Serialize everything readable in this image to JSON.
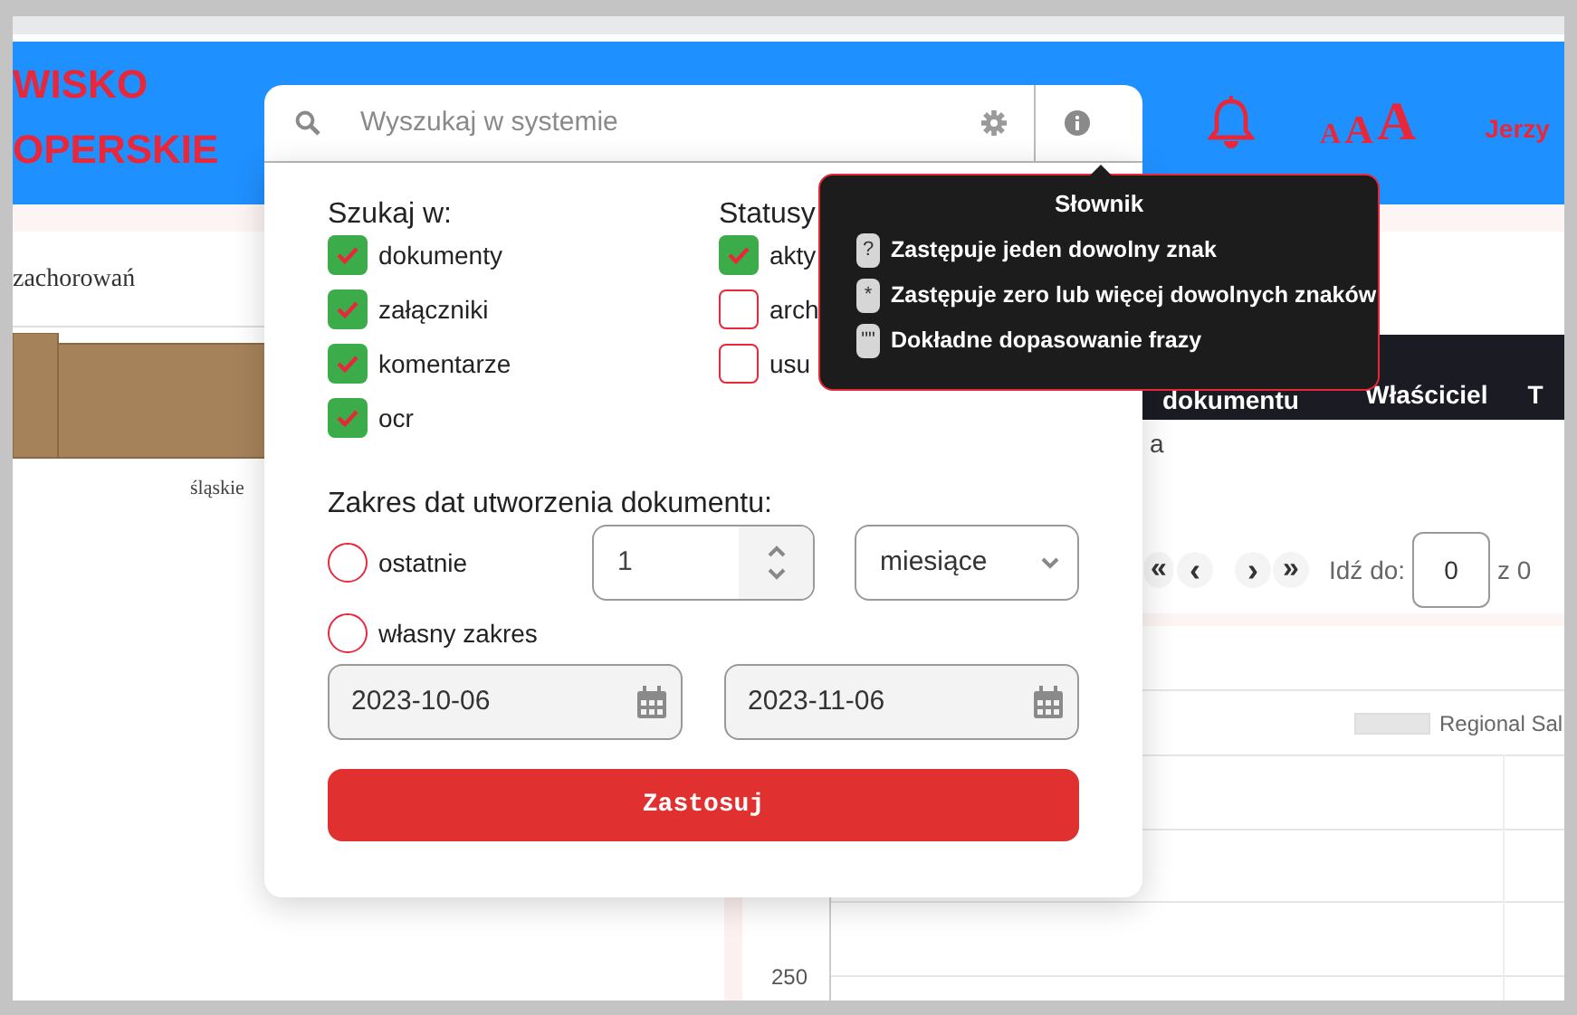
{
  "header": {
    "logo_lines": [
      "WISKO",
      "OPERSKIE"
    ],
    "font_size_labels": [
      "A",
      "A",
      "A"
    ],
    "user": "Jerzy"
  },
  "search": {
    "placeholder": "Wyszukaj w systemie"
  },
  "background": {
    "left_card": {
      "title": "zachorowań",
      "category": "śląskie"
    },
    "table": {
      "columns": [
        "dokumentu",
        "Właściciel",
        "T"
      ],
      "cell": "a"
    },
    "pagination": {
      "first": "«",
      "prev": "‹",
      "next": "›",
      "last": "»",
      "goto_label": "Idź do:",
      "page": "0",
      "total": "z 0"
    },
    "chart": {
      "legend": "Regional Sal",
      "axis_label": "250"
    }
  },
  "search_popup": {
    "search_in": {
      "title": "Szukaj w:",
      "options": [
        {
          "label": "dokumenty",
          "checked": true
        },
        {
          "label": "załączniki",
          "checked": true
        },
        {
          "label": "komentarze",
          "checked": true
        },
        {
          "label": "ocr",
          "checked": true
        }
      ]
    },
    "statuses": {
      "title": "Statusy",
      "options": [
        {
          "label": "akty",
          "checked": true
        },
        {
          "label": "arch",
          "checked": false
        },
        {
          "label": "usu",
          "checked": false
        }
      ]
    },
    "date_range": {
      "title": "Zakres dat utworzenia dokumentu:",
      "last": {
        "label": "ostatnie",
        "selected": false,
        "count": "1",
        "unit": "miesiące"
      },
      "custom": {
        "label": "własny zakres",
        "selected": false,
        "from": "2023-10-06",
        "to": "2023-11-06"
      }
    },
    "apply_button": "Zastosuj"
  },
  "tooltip": {
    "title": "Słownik",
    "items": [
      {
        "key": "?",
        "text": "Zastępuje jeden dowolny znak"
      },
      {
        "key": "*",
        "text": "Zastępuje zero lub więcej dowolnych znaków"
      },
      {
        "key": "\"\"",
        "text": "Dokładne dopasowanie frazy"
      }
    ]
  }
}
